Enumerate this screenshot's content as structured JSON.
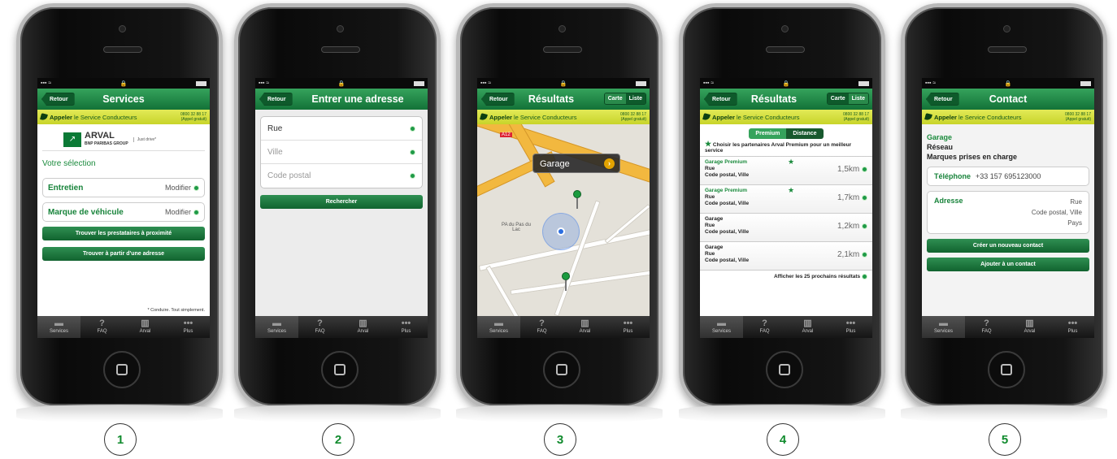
{
  "common": {
    "back": "Retour",
    "call_bold": "Appeler",
    "call_rest": "le Service Conducteurs",
    "call_number": "0800 32 88 17",
    "call_free": "(Appel gratuit)",
    "tabs": [
      "Services",
      "FAQ",
      "Arval",
      "Plus"
    ],
    "tab_icons": [
      "car-icon",
      "question-icon",
      "building-icon",
      "more-icon"
    ]
  },
  "steps": [
    "1",
    "2",
    "3",
    "4",
    "5"
  ],
  "screen1": {
    "title": "Services",
    "brand": "ARVAL",
    "brand_sub": "BNP PARIBAS GROUP",
    "brand_tag": "Just drive*",
    "section": "Votre sélection",
    "items": [
      {
        "label": "Entretien",
        "action": "Modifier"
      },
      {
        "label": "Marque de véhicule",
        "action": "Modifier"
      }
    ],
    "btn_nearby": "Trouver les prestataires à proximité",
    "btn_address": "Trouver à partir d'une adresse",
    "tagline": "* Conduire. Tout simplement."
  },
  "screen2": {
    "title": "Entrer une adresse",
    "fields": [
      "Rue",
      "Ville",
      "Code postal"
    ],
    "search": "Rechercher"
  },
  "screen3": {
    "title": "Résultats",
    "seg": [
      "Carte",
      "Liste"
    ],
    "callout": "Garage",
    "place": "PA du Pas du Lac",
    "road_badge": "A12"
  },
  "screen4": {
    "title": "Résultats",
    "seg": [
      "Carte",
      "Liste"
    ],
    "filter": [
      "Premium",
      "Distance"
    ],
    "choose": "Choisir les partenaires Arval Premium pour un meilleur service",
    "results": [
      {
        "name": "Garage Premium",
        "l2": "Rue",
        "l3": "Code postal, Ville",
        "dist": "1,5km",
        "premium": true
      },
      {
        "name": "Garage Premium",
        "l2": "Rue",
        "l3": "Code postal, Ville",
        "dist": "1,7km",
        "premium": true
      },
      {
        "name": "Garage",
        "l2": "Rue",
        "l3": "Code postal, Ville",
        "dist": "1,2km",
        "premium": false
      },
      {
        "name": "Garage",
        "l2": "Rue",
        "l3": "Code postal, Ville",
        "dist": "2,1km",
        "premium": false
      }
    ],
    "more": "Afficher les 25 prochains résultats"
  },
  "screen5": {
    "title": "Contact",
    "garage": "Garage",
    "network": "Réseau",
    "brands": "Marques prises en charge",
    "phone_label": "Téléphone",
    "phone_value": "+33 157 695123000",
    "addr_label": "Adresse",
    "addr_lines": [
      "Rue",
      "Code postal, Ville",
      "Pays"
    ],
    "btn_new": "Créer un nouveau contact",
    "btn_add": "Ajouter à un contact"
  },
  "colors": {
    "accent": "#1a8a3c",
    "callbar": "#d5de3e"
  }
}
